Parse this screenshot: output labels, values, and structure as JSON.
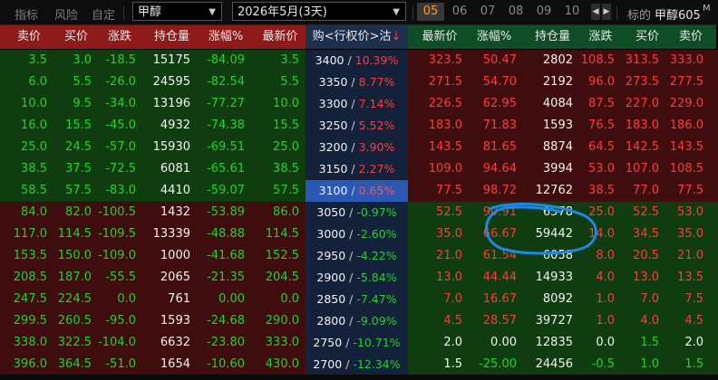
{
  "toolbar": {
    "tabs": [
      "指标",
      "风险",
      "自定"
    ],
    "underlying_select": "甲醇",
    "expiry_select": "2026年5月(3天)",
    "months": [
      "05",
      "06",
      "07",
      "08",
      "09",
      "10"
    ],
    "active_month": "05",
    "corner_prefix": "标的",
    "corner_name": "甲醇605",
    "corner_suffix": "M"
  },
  "headers": {
    "call": [
      "卖价",
      "买价",
      "涨跌",
      "持仓量",
      "涨幅%",
      "最新价"
    ],
    "middle": "购<行权价>沽",
    "middle_arrow": "↓",
    "put": [
      "最新价",
      "涨幅%",
      "持仓量",
      "涨跌",
      "买价",
      "卖价"
    ]
  },
  "rows": [
    {
      "call": [
        "3.5",
        "3.0",
        "-18.5",
        "15175",
        "-84.09",
        "3.5"
      ],
      "strike": "3400",
      "pct": "10.39%",
      "put": [
        "323.5",
        "50.47",
        "2802",
        "108.5",
        "313.5",
        "333.0"
      ]
    },
    {
      "call": [
        "6.0",
        "5.5",
        "-26.0",
        "24595",
        "-82.54",
        "5.5"
      ],
      "strike": "3350",
      "pct": "8.77%",
      "put": [
        "271.5",
        "54.70",
        "2192",
        "96.0",
        "273.5",
        "277.5"
      ]
    },
    {
      "call": [
        "10.0",
        "9.5",
        "-34.0",
        "13196",
        "-77.27",
        "10.0"
      ],
      "strike": "3300",
      "pct": "7.14%",
      "put": [
        "226.5",
        "62.95",
        "4084",
        "87.5",
        "227.0",
        "229.0"
      ]
    },
    {
      "call": [
        "16.0",
        "15.5",
        "-45.0",
        "4932",
        "-74.38",
        "15.5"
      ],
      "strike": "3250",
      "pct": "5.52%",
      "put": [
        "183.0",
        "71.83",
        "1593",
        "76.5",
        "183.0",
        "186.0"
      ]
    },
    {
      "call": [
        "25.0",
        "24.5",
        "-57.0",
        "15930",
        "-69.51",
        "25.0"
      ],
      "strike": "3200",
      "pct": "3.90%",
      "put": [
        "143.5",
        "81.65",
        "8874",
        "64.5",
        "142.5",
        "143.5"
      ]
    },
    {
      "call": [
        "38.5",
        "37.5",
        "-72.5",
        "6081",
        "-65.61",
        "38.5"
      ],
      "strike": "3150",
      "pct": "2.27%",
      "put": [
        "109.0",
        "94.64",
        "3994",
        "53.0",
        "107.0",
        "108.5"
      ]
    },
    {
      "call": [
        "58.5",
        "57.5",
        "-83.0",
        "4410",
        "-59.07",
        "57.5"
      ],
      "strike": "3100",
      "pct": "0.65%",
      "put": [
        "77.5",
        "98.72",
        "12762",
        "38.5",
        "77.0",
        "77.5"
      ]
    },
    {
      "call": [
        "84.0",
        "82.0",
        "-100.5",
        "1432",
        "-53.89",
        "86.0"
      ],
      "strike": "3050",
      "pct": "-0.97%",
      "put": [
        "52.5",
        "90.91",
        "6578",
        "25.0",
        "52.5",
        "53.0"
      ]
    },
    {
      "call": [
        "117.0",
        "114.5",
        "-109.5",
        "13339",
        "-48.88",
        "114.5"
      ],
      "strike": "3000",
      "pct": "-2.60%",
      "put": [
        "35.0",
        "66.67",
        "59442",
        "14.0",
        "34.5",
        "35.0"
      ]
    },
    {
      "call": [
        "153.5",
        "150.0",
        "-109.0",
        "1000",
        "-41.68",
        "152.5"
      ],
      "strike": "2950",
      "pct": "-4.22%",
      "put": [
        "21.0",
        "61.54",
        "6058",
        "8.0",
        "20.5",
        "21.0"
      ]
    },
    {
      "call": [
        "208.5",
        "187.0",
        "-55.5",
        "2065",
        "-21.35",
        "204.5"
      ],
      "strike": "2900",
      "pct": "-5.84%",
      "put": [
        "13.0",
        "44.44",
        "14933",
        "4.0",
        "13.0",
        "13.5"
      ]
    },
    {
      "call": [
        "247.5",
        "224.5",
        "0.0",
        "761",
        "0.00",
        "0.0"
      ],
      "strike": "2850",
      "pct": "-7.47%",
      "put": [
        "7.0",
        "16.67",
        "8092",
        "1.0",
        "7.0",
        "7.5"
      ]
    },
    {
      "call": [
        "299.5",
        "260.5",
        "-95.0",
        "1593",
        "-24.68",
        "290.0"
      ],
      "strike": "2800",
      "pct": "-9.09%",
      "put": [
        "4.5",
        "28.57",
        "39727",
        "1.0",
        "4.0",
        "4.5"
      ]
    },
    {
      "call": [
        "338.0",
        "322.5",
        "-104.0",
        "6632",
        "-23.80",
        "333.0"
      ],
      "strike": "2750",
      "pct": "-10.71%",
      "put": [
        "2.0",
        "0.00",
        "12835",
        "0.0",
        "1.5",
        "2.0"
      ]
    },
    {
      "call": [
        "396.0",
        "364.5",
        "-51.0",
        "1654",
        "-10.60",
        "430.0"
      ],
      "strike": "2700",
      "pct": "-12.34%",
      "put": [
        "1.5",
        "-25.00",
        "24456",
        "-0.5",
        "1.0",
        "1.5"
      ]
    }
  ],
  "selected_strike": "3100",
  "colors": {
    "call_itm_bg": "#103d10",
    "call_otm_bg": "#3f0d0d",
    "put_otm_bg": "#3f0d0d",
    "put_itm_bg": "#103d10",
    "selected_strike_bg": "#2a59b5",
    "annotation": "#1e88e5"
  }
}
